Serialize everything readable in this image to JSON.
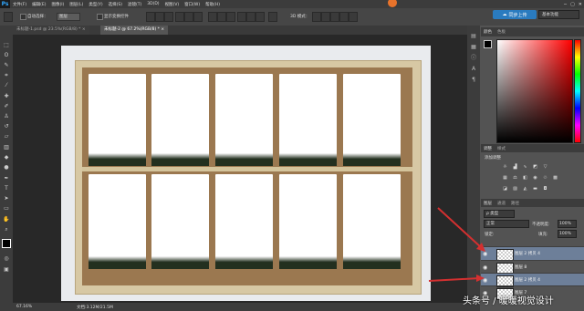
{
  "app": {
    "logo": "Ps"
  },
  "menu": [
    "文件(F)",
    "编辑(E)",
    "图像(I)",
    "图层(L)",
    "类型(Y)",
    "选择(S)",
    "滤镜(T)",
    "3D(D)",
    "视图(V)",
    "窗口(W)",
    "帮助(H)"
  ],
  "window_controls": [
    "─",
    "▢",
    "✕"
  ],
  "options": {
    "auto_select_label": "自动选择：",
    "auto_select_value": "图层",
    "show_transform_label": "显示变换控件",
    "mode_3d": "3D 模式：",
    "share_label": "同步上传",
    "workspace": "基本功能"
  },
  "tabs": [
    {
      "label": "未标题-1.psd @ 23.5%(RGB/8) *",
      "active": false
    },
    {
      "label": "未标题-2 @ 67.2%(RGB/8) *",
      "active": true
    }
  ],
  "status": {
    "zoom": "67.16%",
    "doc": "文档:3.12M/21.5M"
  },
  "panels": {
    "color": {
      "tab1": "颜色",
      "tab2": "色板"
    },
    "adjustments": {
      "tab1": "调整",
      "tab2": "样式",
      "subtitle": "添加调整"
    },
    "layers": {
      "tab1": "图层",
      "tab2": "通道",
      "tab3": "路径",
      "kind_filter": "ρ 类型",
      "blend_mode": "正常",
      "opacity_label": "不透明度:",
      "opacity_value": "100%",
      "lock_label": "锁定:",
      "fill_label": "填充:",
      "fill_value": "100%",
      "items": [
        {
          "name": "图层 2 拷贝 4",
          "selected": true
        },
        {
          "name": "图层 8",
          "selected": false
        },
        {
          "name": "图层 2 拷贝 4",
          "selected": true
        },
        {
          "name": "图层 7",
          "selected": false
        }
      ]
    }
  },
  "watermark": "头条号 / 暖暖视觉设计",
  "colors": {
    "accent": "#31a8ff",
    "selected_layer": "#6d7f99",
    "arrow": "#d43030",
    "cork": "#9b7850",
    "frame": "#d7c8a4"
  }
}
